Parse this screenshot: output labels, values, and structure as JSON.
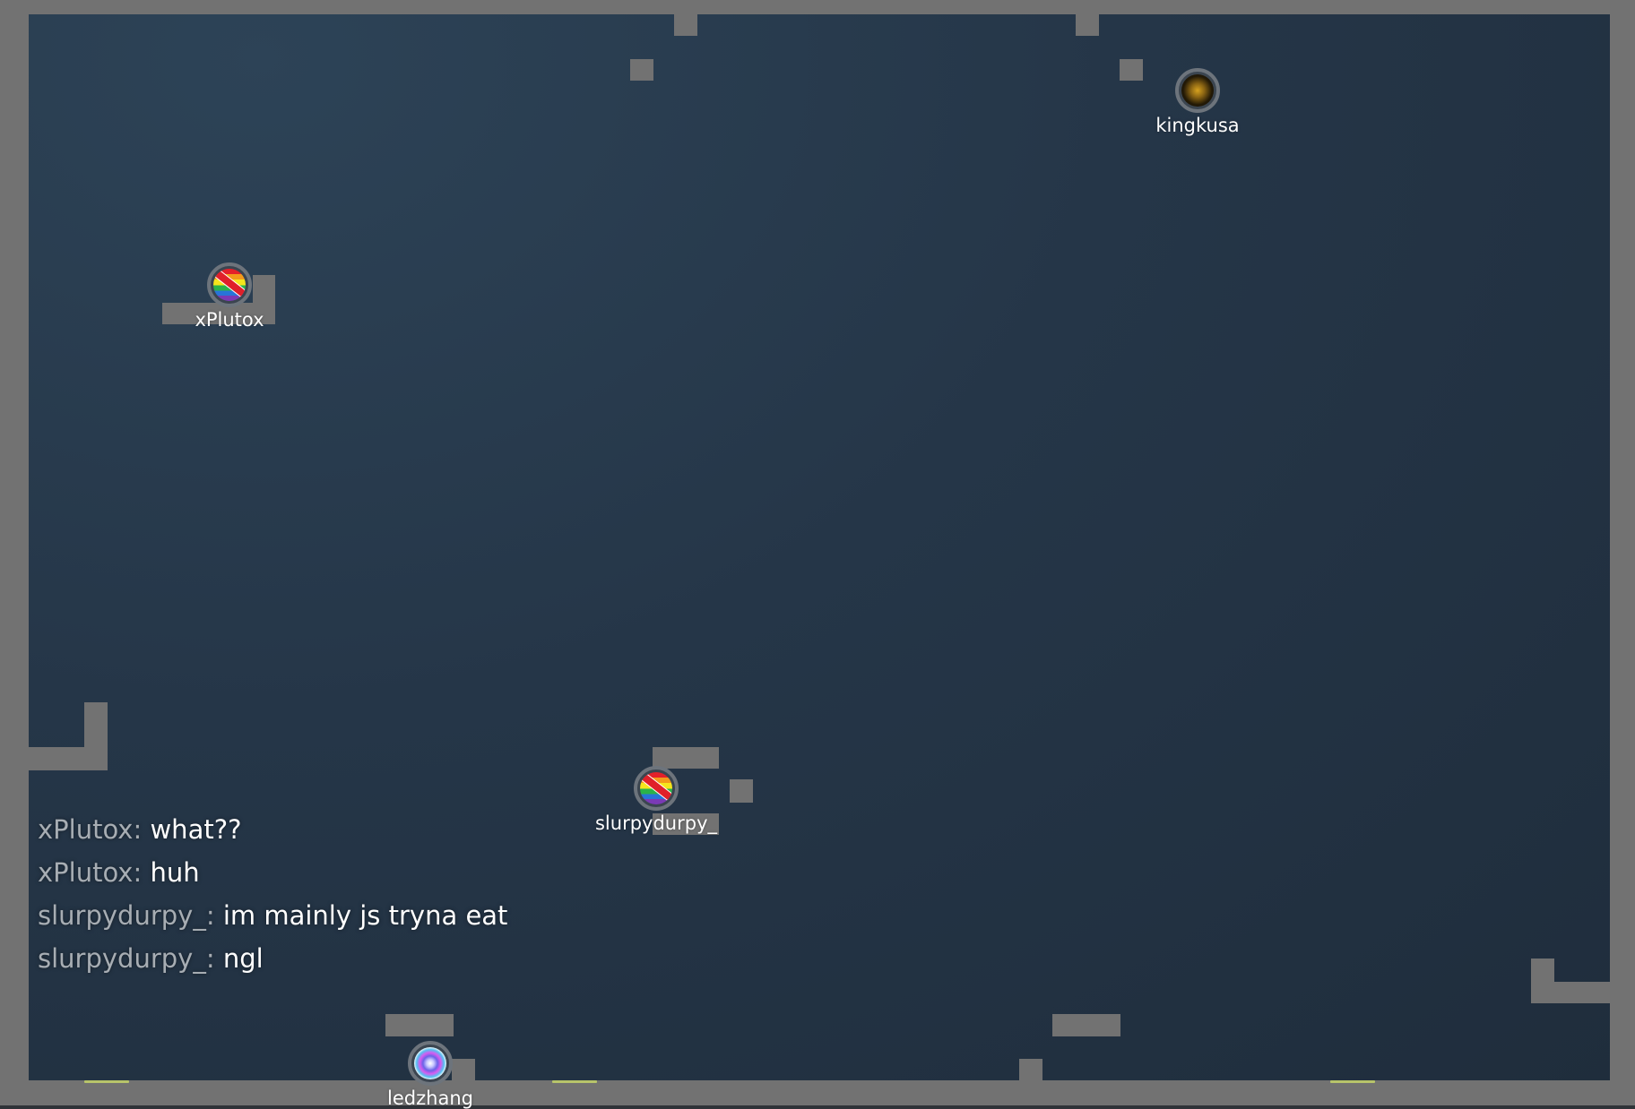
{
  "players": [
    {
      "name": "kingkusa",
      "skin": "gold-orb"
    },
    {
      "name": "xPlutox",
      "skin": "rainbow-prohibited"
    },
    {
      "name": "slurpydurpy_",
      "skin": "rainbow-prohibited"
    },
    {
      "name": "ledzhang",
      "skin": "blue-swirl"
    }
  ],
  "chat": [
    {
      "name": "xPlutox:",
      "message": "what??"
    },
    {
      "name": "xPlutox:",
      "message": "huh"
    },
    {
      "name": "slurpydurpy_:",
      "message": "im mainly js tryna eat"
    },
    {
      "name": "slurpydurpy_:",
      "message": "ngl"
    }
  ],
  "colors": {
    "wall": "#727272",
    "floor": "#253648",
    "pad": "#b8c46a",
    "chat_name": "#a7adb3",
    "chat_message": "#ffffff"
  }
}
